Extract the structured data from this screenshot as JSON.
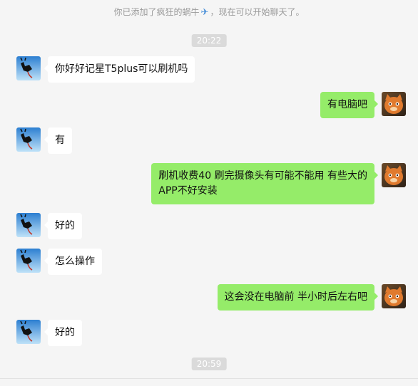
{
  "system_notice": {
    "prefix": "你已添加了疯狂的蜗牛",
    "icon": "airplane-icon",
    "suffix": "，现在可以开始聊天了。"
  },
  "timestamps": [
    "20:22",
    "20:59"
  ],
  "messages": [
    {
      "side": "in",
      "text": "你好好记星T5plus可以刷机吗"
    },
    {
      "side": "out",
      "text": "有电脑吧"
    },
    {
      "side": "in",
      "text": "有"
    },
    {
      "side": "out",
      "line1": "刷机收费40  刷完摄像头有可能不能用  有些大的",
      "line2": "APP不好安装"
    },
    {
      "side": "in",
      "text": "好的"
    },
    {
      "side": "in",
      "text": "怎么操作"
    },
    {
      "side": "out",
      "text": "这会没在电脑前  半小时后左右吧"
    },
    {
      "side": "in",
      "text": "好的"
    }
  ],
  "colors": {
    "background": "#f5f5f5",
    "outgoing_bubble": "#95ec69",
    "incoming_bubble": "#ffffff",
    "timestamp_bg": "#dadada"
  }
}
